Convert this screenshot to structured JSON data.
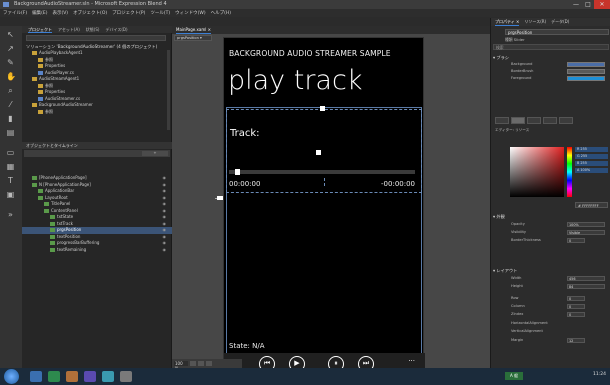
{
  "window": {
    "title": "BackgroundAudioStreamer.sln - Microsoft Expression Blend 4",
    "controls": [
      "—",
      "□",
      "✕"
    ]
  },
  "menubar": {
    "items": [
      "ファイル(F)",
      "編集(E)",
      "表示(V)",
      "オブジェクト(O)",
      "プロジェクト(P)",
      "ツール(T)",
      "ウィンドウ(W)",
      "ヘルプ(H)"
    ]
  },
  "leftpanel": {
    "tabs": [
      "プロジェクト",
      "アセット(A)",
      "状態(S)",
      "デバイス(D)"
    ],
    "project_root": "ソリューション 'BackgroundAudioStreamer' (4 個のプロジェクト)",
    "tree": [
      {
        "label": "AudioPlaybackAgent1",
        "indent": 1,
        "type": "folder"
      },
      {
        "label": "参照",
        "indent": 2,
        "type": "folder"
      },
      {
        "label": "Properties",
        "indent": 2,
        "type": "folder"
      },
      {
        "label": "AudioPlayer.cs",
        "indent": 2,
        "type": "file"
      },
      {
        "label": "AudioStreamAgent1",
        "indent": 1,
        "type": "folder"
      },
      {
        "label": "参照",
        "indent": 2,
        "type": "folder"
      },
      {
        "label": "Properties",
        "indent": 2,
        "type": "folder"
      },
      {
        "label": "AudioStreamer.cs",
        "indent": 2,
        "type": "file"
      },
      {
        "label": "BackgroundAudioStreamer",
        "indent": 1,
        "type": "folder"
      },
      {
        "label": "参照",
        "indent": 2,
        "type": "folder"
      }
    ],
    "objects_header": "オブジェクトとタイムライン",
    "objects_button": "+",
    "objects_tree": [
      {
        "label": "[PhoneApplicationPage]",
        "indent": 1,
        "selected": false
      },
      {
        "label": "N [PhoneApplicationPage]",
        "indent": 1,
        "selected": false
      },
      {
        "label": "ApplicationBar",
        "indent": 2,
        "selected": false
      },
      {
        "label": "LayoutRoot",
        "indent": 2,
        "selected": false
      },
      {
        "label": "TitlePanel",
        "indent": 3,
        "selected": false
      },
      {
        "label": "ContentPanel",
        "indent": 3,
        "selected": false
      },
      {
        "label": "txtState",
        "indent": 4,
        "selected": false
      },
      {
        "label": "txtTrack",
        "indent": 4,
        "selected": false
      },
      {
        "label": "prgsPosition",
        "indent": 4,
        "selected": true
      },
      {
        "label": "textPosition",
        "indent": 4,
        "selected": false
      },
      {
        "label": "progressBarBuffering",
        "indent": 4,
        "selected": false
      },
      {
        "label": "textRemaining",
        "indent": 4,
        "selected": false
      }
    ]
  },
  "designer": {
    "tabs": [
      "MainPage.xaml ×"
    ],
    "breadcrumb": "prgsPosition ▾",
    "zoom": "100 %"
  },
  "phone": {
    "app_title": "BACKGROUND AUDIO STREAMER SAMPLE",
    "page_title": "play track",
    "track_label": "Track:",
    "time_elapsed": "00:00:00",
    "time_remaining": "-00:00:00",
    "status": "State: N/A",
    "progress_value": 0.02,
    "appbar_buttons": [
      {
        "name": "previous-icon",
        "glyph": "⏮"
      },
      {
        "name": "play-icon",
        "glyph": "▶"
      },
      {
        "name": "pause-icon",
        "glyph": "⏸"
      },
      {
        "name": "next-icon",
        "glyph": "⏭"
      }
    ],
    "ellipsis": "..."
  },
  "rightpanel": {
    "tabs": [
      "プロパティ ×",
      "リソース(R)",
      "データ(D)"
    ],
    "name": "prgsPosition",
    "type": "種類 Slider",
    "search": "検索",
    "brush_section": "▾ ブラシ",
    "brush_rows": [
      {
        "label": "Background",
        "color": "#4b6ea8"
      },
      {
        "label": "BorderBrush",
        "color": "#5a5a5a"
      },
      {
        "label": "Foreground",
        "color": "#1e90d8"
      }
    ],
    "editor_label": "エディター: リソース",
    "rgb": [
      "R 255",
      "G 255",
      "B 255",
      "A 100%"
    ],
    "hex": "# FFFFFFFF",
    "appearance_section": "▾ 外観",
    "appearance_rows": [
      {
        "label": "Opacity",
        "value": "100%"
      },
      {
        "label": "Visibility",
        "value": "Visible"
      },
      {
        "label": "BorderThickness",
        "value": "0"
      }
    ],
    "layout_section": "▾ レイアウト",
    "layout_rows": [
      {
        "label": "Width",
        "value": "456"
      },
      {
        "label": "Height",
        "value": "84"
      },
      {
        "label": "Row",
        "value": "0"
      },
      {
        "label": "Column",
        "value": "0"
      },
      {
        "label": "ZIndex",
        "value": "0"
      },
      {
        "label": "HorizontalAlignment",
        "value": ""
      },
      {
        "label": "VerticalAlignment",
        "value": ""
      },
      {
        "label": "Margin",
        "value": "12"
      }
    ]
  },
  "taskbar": {
    "ime": "A 般",
    "clock": "11:24"
  },
  "colors": {
    "selection": "#3b5477",
    "accent": "#3c7fd4",
    "phone_bg": "#000000",
    "close": "#c7342b"
  }
}
